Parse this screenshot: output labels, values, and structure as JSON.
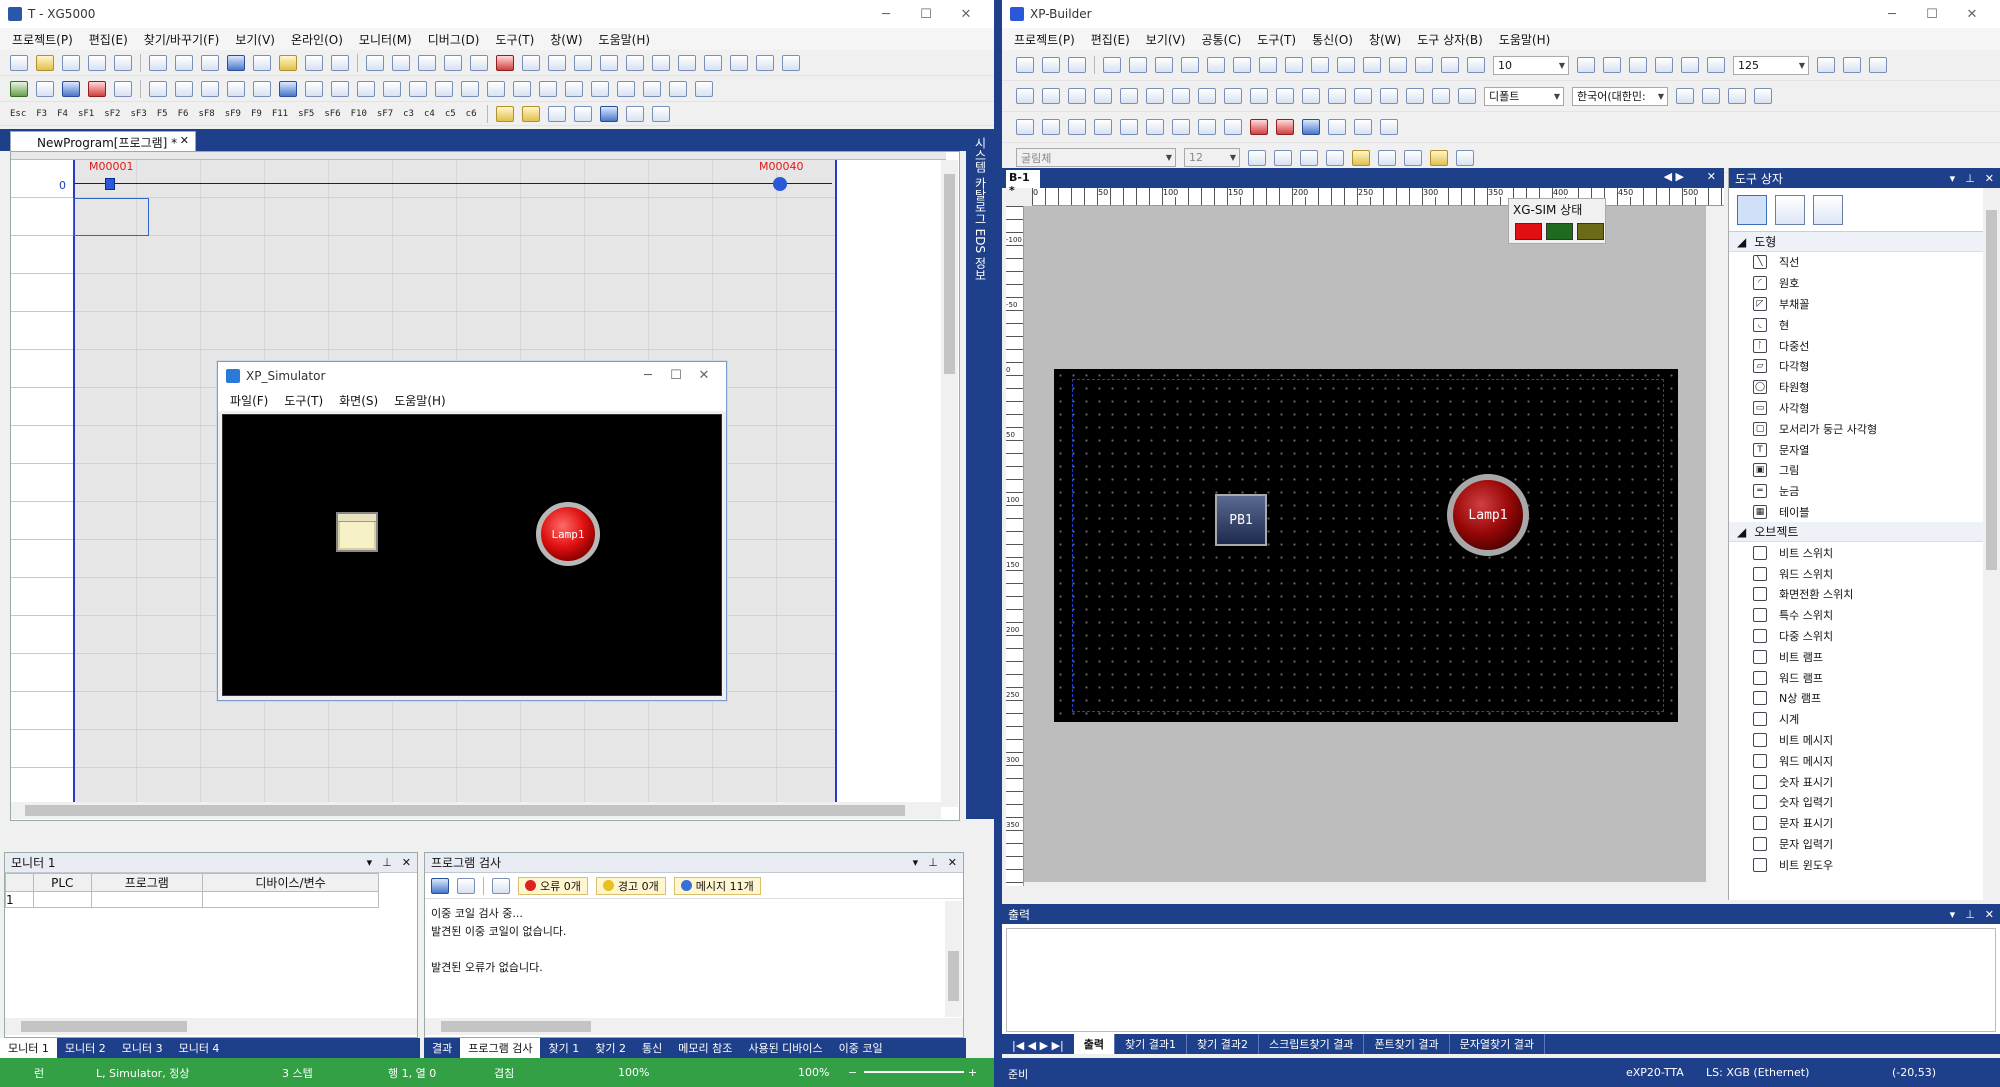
{
  "left": {
    "title": "T - XG5000",
    "menu": [
      "프로젝트(P)",
      "편집(E)",
      "찾기/바꾸기(F)",
      "보기(V)",
      "온라인(O)",
      "모니터(M)",
      "디버그(D)",
      "도구(T)",
      "창(W)",
      "도움말(H)"
    ],
    "fkeys": [
      "F3",
      "F4",
      "sF1",
      "sF2",
      "sF3",
      "F5",
      "F6",
      "sF8",
      "sF9",
      "F9",
      "F11",
      "sF5",
      "sF6",
      "F10",
      "sF7",
      "c3",
      "c4",
      "c5",
      "c6"
    ],
    "doc_tab": "NewProgram[프로그램] *",
    "rung_number": "0",
    "contact_label": "M00001",
    "coil_label": "M00040",
    "side_tab": "시스템 카탈로그 EDS 정보",
    "monitor": {
      "title": "모니터 1",
      "columns": [
        "PLC",
        "프로그램",
        "디바이스/변수"
      ],
      "row_number": "1",
      "tabs": [
        "모니터 1",
        "모니터 2",
        "모니터 3",
        "모니터 4"
      ]
    },
    "check": {
      "title": "프로그램 검사",
      "errors": "오류 0개",
      "warnings": "경고 0개",
      "messages": "메시지 11개",
      "log": [
        "이중 코일 검사 중...",
        "발견된 이중 코일이 없습니다.",
        "",
        "발견된 오류가 없습니다."
      ],
      "tabs": [
        "결과",
        "프로그램 검사",
        "찾기 1",
        "찾기 2",
        "통신",
        "메모리 참조",
        "사용된 디바이스",
        "이중 코일"
      ]
    },
    "status": {
      "mode": "런",
      "plc": "L, Simulator, 정상",
      "steps": "3 스텝",
      "position": "행 1, 열 0",
      "overwrite": "겹침",
      "zoom1": "100%",
      "zoom2": "100%"
    }
  },
  "simulator": {
    "title": "XP_Simulator",
    "menu": [
      "파일(F)",
      "도구(T)",
      "화면(S)",
      "도움말(H)"
    ],
    "lamp_label": "Lamp1"
  },
  "right": {
    "title": "XP-Builder",
    "menu": [
      "프로젝트(P)",
      "편집(E)",
      "보기(V)",
      "공통(C)",
      "도구(T)",
      "통신(O)",
      "창(W)",
      "도구 상자(B)",
      "도움말(H)"
    ],
    "combo_grid": "10",
    "combo_zoom": "125",
    "combo_style": "디폴트",
    "combo_lang": "한국어(대한민:",
    "combo_font": "굴림체",
    "combo_fontsize": "12",
    "editor_tab": "B-1 *",
    "ruler_h": [
      "0",
      "50",
      "100",
      "150",
      "200",
      "250",
      "300",
      "350",
      "400",
      "450",
      "500"
    ],
    "ruler_v": [
      "-100",
      "-50",
      "0",
      "50",
      "100",
      "150",
      "200",
      "250",
      "300",
      "350"
    ],
    "pb_label": "PB1",
    "lamp_label": "Lamp1",
    "xgsim_title": "XG-SIM 상태",
    "xgsim_colors": [
      "#e01010",
      "#1f6a1f",
      "#6a6a18"
    ],
    "toolbox": {
      "title": "도구 상자",
      "shapes_title": "도형",
      "shapes": [
        "직선",
        "원호",
        "부채꼴",
        "현",
        "다중선",
        "다각형",
        "타원형",
        "사각형",
        "모서리가 둥근 사각형",
        "문자열",
        "그림",
        "눈금",
        "테이블"
      ],
      "objects_title": "오브젝트",
      "objects": [
        "비트 스위치",
        "워드 스위치",
        "화면전환 스위치",
        "특수 스위치",
        "다중 스위치",
        "비트 램프",
        "워드 램프",
        "N상 램프",
        "시계",
        "비트 메시지",
        "워드 메시지",
        "숫자 표시기",
        "숫자 입력기",
        "문자 표시기",
        "문자 입력기",
        "비트 윈도우"
      ]
    },
    "output": {
      "title": "출력",
      "tabs": [
        "출력",
        "찾기 결과1",
        "찾기 결과2",
        "스크립트찾기 결과",
        "폰트찾기 결과",
        "문자열찾기 결과"
      ]
    },
    "status": {
      "ready": "준비",
      "device": "eXP20-TTA",
      "connection": "LS: XGB (Ethernet)",
      "coords": "(-20,53)"
    }
  }
}
